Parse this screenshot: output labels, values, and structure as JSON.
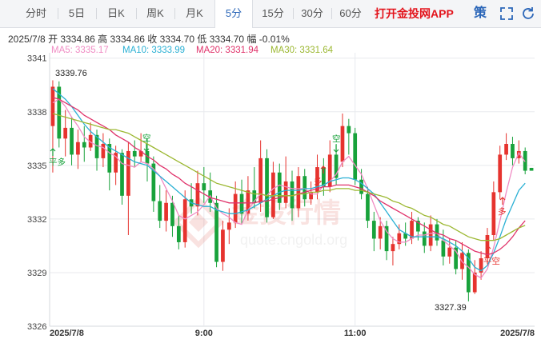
{
  "tabs": [
    {
      "label": "分时"
    },
    {
      "label": "5日"
    },
    {
      "label": "日K"
    },
    {
      "label": "周K"
    },
    {
      "label": "月K"
    },
    {
      "label": "5分"
    },
    {
      "label": "15分"
    },
    {
      "label": "30分"
    },
    {
      "label": "60分"
    }
  ],
  "active_tab": "5分",
  "promo_text": "打开金投网APP",
  "strategy_label": "策",
  "icons": [
    "fullscreen-icon",
    "refresh-icon"
  ],
  "info": {
    "date": "2025/7/8",
    "open_label": "开",
    "open": "3334.86",
    "high_label": "高",
    "high": "3334.86",
    "close_label": "收",
    "close": "3334.70",
    "low_label": "低",
    "low": "3334.70",
    "amp_label": "幅",
    "amp": "-0.01%"
  },
  "ma_legend": [
    {
      "text": "MA5: 3335.17",
      "color": "#f08cc4"
    },
    {
      "text": "MA10: 3333.99",
      "color": "#2ab0d4"
    },
    {
      "text": "MA20: 3331.94",
      "color": "#e0336b"
    },
    {
      "text": "MA30: 3331.64",
      "color": "#9cb832"
    }
  ],
  "watermark": {
    "text": "金投行情",
    "url": "quote.cngold.org"
  },
  "colors": {
    "up": "#e6332e",
    "down": "#18a23b"
  },
  "chart_data": {
    "type": "candlestick",
    "yticks": [
      3341,
      3338,
      3335,
      3332,
      3329,
      3326
    ],
    "ylim": [
      3326,
      3341.3
    ],
    "xlabels": [
      {
        "text": "2025/7/8",
        "index": 0
      },
      {
        "text": "9:00",
        "index": 24
      },
      {
        "text": "11:00",
        "index": 48
      },
      {
        "text": "2025/7/8",
        "index": 72
      }
    ],
    "annotations": [
      {
        "text": "3339.76",
        "type": "high"
      },
      {
        "text": "3327.39",
        "type": "low"
      },
      {
        "text": "平多",
        "type": "signal"
      },
      {
        "text": "空",
        "type": "signal"
      },
      {
        "text": "空",
        "type": "signal"
      },
      {
        "text": "多",
        "type": "signal"
      },
      {
        "text": "多",
        "type": "signal"
      },
      {
        "text": "平空",
        "type": "signal"
      }
    ],
    "candles": [
      [
        3337.2,
        3339.4,
        3339.76,
        3334.6
      ],
      [
        3339.4,
        3336.5,
        3339.7,
        3336.0
      ],
      [
        3336.5,
        3337.1,
        3338.1,
        3335.5
      ],
      [
        3337.1,
        3335.6,
        3337.7,
        3335.0
      ],
      [
        3335.6,
        3336.3,
        3337.0,
        3334.8
      ],
      [
        3336.3,
        3336.0,
        3337.2,
        3335.2
      ],
      [
        3336.0,
        3336.7,
        3337.4,
        3335.8
      ],
      [
        3336.7,
        3335.4,
        3337.0,
        3334.7
      ],
      [
        3335.4,
        3336.2,
        3336.8,
        3334.9
      ],
      [
        3336.2,
        3334.6,
        3336.5,
        3333.6
      ],
      [
        3334.6,
        3335.7,
        3336.1,
        3333.9
      ],
      [
        3335.7,
        3333.3,
        3335.9,
        3332.8
      ],
      [
        3333.3,
        3335.8,
        3336.3,
        3331.1
      ],
      [
        3335.8,
        3335.5,
        3336.4,
        3334.9
      ],
      [
        3335.5,
        3335.8,
        3336.8,
        3335.2
      ],
      [
        3335.8,
        3335.1,
        3336.5,
        3334.1
      ],
      [
        3335.1,
        3333.0,
        3335.5,
        3332.4
      ],
      [
        3333.0,
        3331.9,
        3333.9,
        3331.5
      ],
      [
        3331.9,
        3332.9,
        3333.6,
        3331.3
      ],
      [
        3332.9,
        3331.6,
        3333.3,
        3331.0
      ],
      [
        3331.6,
        3330.7,
        3332.2,
        3330.3
      ],
      [
        3330.7,
        3333.1,
        3333.6,
        3330.4
      ],
      [
        3333.1,
        3332.7,
        3334.0,
        3332.3
      ],
      [
        3332.7,
        3334.0,
        3334.7,
        3332.2
      ],
      [
        3334.0,
        3333.6,
        3334.9,
        3332.9
      ],
      [
        3333.6,
        3332.9,
        3334.6,
        3332.4
      ],
      [
        3332.9,
        3329.6,
        3333.3,
        3329.3
      ],
      [
        3329.6,
        3331.4,
        3331.9,
        3329.1
      ],
      [
        3331.4,
        3331.8,
        3332.6,
        3330.6
      ],
      [
        3331.8,
        3333.4,
        3334.1,
        3331.5
      ],
      [
        3333.4,
        3332.3,
        3334.2,
        3331.7
      ],
      [
        3332.3,
        3333.6,
        3334.4,
        3331.9
      ],
      [
        3333.6,
        3332.9,
        3334.9,
        3332.6
      ],
      [
        3332.9,
        3335.4,
        3336.4,
        3332.4
      ],
      [
        3335.4,
        3332.1,
        3335.9,
        3331.8
      ],
      [
        3332.1,
        3334.6,
        3335.2,
        3332.0
      ],
      [
        3334.6,
        3332.9,
        3335.1,
        3332.5
      ],
      [
        3332.9,
        3334.1,
        3335.5,
        3332.6
      ],
      [
        3334.1,
        3332.6,
        3334.7,
        3331.9
      ],
      [
        3332.6,
        3334.4,
        3334.9,
        3332.1
      ],
      [
        3334.4,
        3333.1,
        3334.8,
        3332.7
      ],
      [
        3333.1,
        3333.5,
        3334.1,
        3332.8
      ],
      [
        3333.5,
        3334.9,
        3335.6,
        3333.1
      ],
      [
        3334.9,
        3333.8,
        3335.4,
        3333.3
      ],
      [
        3333.8,
        3335.6,
        3336.4,
        3333.5
      ],
      [
        3335.6,
        3334.3,
        3336.2,
        3333.9
      ],
      [
        3335.2,
        3337.2,
        3337.9,
        3334.9
      ],
      [
        3337.2,
        3336.8,
        3337.6,
        3335.6
      ],
      [
        3336.8,
        3334.2,
        3337.1,
        3333.9
      ],
      [
        3334.2,
        3333.4,
        3334.8,
        3333.1
      ],
      [
        3333.4,
        3331.9,
        3333.8,
        3331.5
      ],
      [
        3331.9,
        3330.9,
        3332.4,
        3330.2
      ],
      [
        3330.9,
        3331.6,
        3332.1,
        3330.3
      ],
      [
        3331.6,
        3330.2,
        3331.9,
        3329.7
      ],
      [
        3330.2,
        3330.6,
        3331.0,
        3329.4
      ],
      [
        3330.6,
        3331.2,
        3331.7,
        3330.3
      ],
      [
        3331.2,
        3330.9,
        3331.8,
        3330.5
      ],
      [
        3330.9,
        3331.9,
        3332.4,
        3330.6
      ],
      [
        3331.9,
        3331.3,
        3332.1,
        3330.8
      ],
      [
        3331.3,
        3330.5,
        3331.8,
        3330.1
      ],
      [
        3330.5,
        3331.7,
        3332.2,
        3330.2
      ],
      [
        3331.7,
        3330.8,
        3332.0,
        3330.5
      ],
      [
        3330.8,
        3329.9,
        3331.4,
        3329.4
      ],
      [
        3329.9,
        3330.4,
        3330.9,
        3329.5
      ],
      [
        3330.4,
        3329.2,
        3330.8,
        3328.9
      ],
      [
        3329.2,
        3330.1,
        3330.7,
        3328.6
      ],
      [
        3330.1,
        3327.9,
        3330.3,
        3327.39
      ],
      [
        3327.9,
        3329.0,
        3329.7,
        3327.8
      ],
      [
        3329.0,
        3329.8,
        3330.2,
        3328.6
      ],
      [
        3329.8,
        3331.1,
        3331.5,
        3329.5
      ],
      [
        3331.1,
        3333.5,
        3334.1,
        3330.8
      ],
      [
        3333.5,
        3335.6,
        3336.1,
        3333.1
      ],
      [
        3335.6,
        3336.2,
        3336.8,
        3335.3
      ],
      [
        3336.2,
        3335.4,
        3336.6,
        3335.0
      ],
      [
        3335.4,
        3335.8,
        3336.4,
        3335.1
      ],
      [
        3335.8,
        3334.7,
        3336.0,
        3334.5
      ],
      [
        3334.86,
        3334.7,
        3334.86,
        3334.7
      ]
    ],
    "series": [
      {
        "name": "MA5",
        "values": [
          3338.5,
          3338.7,
          3338.3,
          3337.7,
          3337.2,
          3336.6,
          3336.3,
          3336.1,
          3336.0,
          3335.7,
          3335.5,
          3335.1,
          3335.0,
          3334.9,
          3335.2,
          3335.1,
          3334.8,
          3334.4,
          3333.7,
          3333.0,
          3332.2,
          3332.0,
          3332.2,
          3332.4,
          3332.8,
          3333.3,
          3332.6,
          3332.3,
          3332.1,
          3331.8,
          3331.7,
          3332.5,
          3333.0,
          3333.4,
          3333.3,
          3333.7,
          3333.9,
          3333.8,
          3333.7,
          3333.7,
          3333.7,
          3333.4,
          3333.4,
          3333.9,
          3334.1,
          3334.5,
          3335.2,
          3335.5,
          3335.0,
          3334.5,
          3333.7,
          3332.8,
          3331.9,
          3331.3,
          3330.9,
          3330.7,
          3330.7,
          3330.9,
          3331.1,
          3331.1,
          3331.2,
          3331.2,
          3330.8,
          3330.5,
          3330.2,
          3329.6,
          3329.3,
          3328.9,
          3328.7,
          3329.2,
          3330.4,
          3331.9,
          3333.5,
          3334.9,
          3335.7,
          3335.2
        ]
      },
      {
        "name": "MA10",
        "values": [
          3339.3,
          3339.0,
          3338.7,
          3338.3,
          3337.8,
          3337.3,
          3336.9,
          3336.6,
          3336.3,
          3336.0,
          3335.8,
          3335.6,
          3335.4,
          3335.2,
          3335.1,
          3335.0,
          3334.7,
          3334.4,
          3334.1,
          3333.8,
          3333.5,
          3333.2,
          3332.9,
          3332.8,
          3332.7,
          3332.7,
          3332.5,
          3332.4,
          3332.3,
          3332.3,
          3332.4,
          3332.5,
          3332.7,
          3332.9,
          3333.1,
          3333.3,
          3333.5,
          3333.6,
          3333.6,
          3333.6,
          3333.7,
          3333.7,
          3333.8,
          3333.9,
          3334.1,
          3334.2,
          3334.3,
          3334.3,
          3334.2,
          3334.0,
          3333.7,
          3333.4,
          3332.9,
          3332.4,
          3331.9,
          3331.4,
          3331.2,
          3331.0,
          3331.0,
          3331.0,
          3331.0,
          3331.0,
          3330.9,
          3330.7,
          3330.5,
          3330.2,
          3329.8,
          3329.3,
          3329.1,
          3329.4,
          3330.1,
          3331.0,
          3332.0,
          3332.8,
          3333.6,
          3334.0
        ]
      },
      {
        "name": "MA20",
        "values": [
          3338.8,
          3338.7,
          3338.5,
          3338.3,
          3338.1,
          3337.8,
          3337.6,
          3337.4,
          3337.2,
          3337.0,
          3336.7,
          3336.5,
          3336.3,
          3336.0,
          3335.8,
          3335.5,
          3335.3,
          3335.0,
          3334.8,
          3334.5,
          3334.3,
          3334.0,
          3333.8,
          3333.6,
          3333.4,
          3333.2,
          3333.1,
          3333.0,
          3332.9,
          3332.9,
          3332.9,
          3332.9,
          3332.9,
          3333.0,
          3333.0,
          3333.1,
          3333.2,
          3333.3,
          3333.3,
          3333.4,
          3333.5,
          3333.6,
          3333.7,
          3333.8,
          3333.8,
          3333.9,
          3333.9,
          3333.9,
          3333.8,
          3333.7,
          3333.5,
          3333.3,
          3333.0,
          3332.8,
          3332.6,
          3332.4,
          3332.2,
          3332.0,
          3331.8,
          3331.6,
          3331.4,
          3331.2,
          3331.1,
          3330.9,
          3330.8,
          3330.6,
          3330.4,
          3330.2,
          3330.1,
          3330.0,
          3330.1,
          3330.3,
          3330.6,
          3331.0,
          3331.5,
          3331.9
        ]
      },
      {
        "name": "MA30",
        "values": [
          3337.9,
          3337.8,
          3337.7,
          3337.6,
          3337.5,
          3337.4,
          3337.3,
          3337.2,
          3337.1,
          3337.0,
          3337.0,
          3336.9,
          3336.8,
          3336.6,
          3336.4,
          3336.2,
          3336.0,
          3335.8,
          3335.6,
          3335.4,
          3335.2,
          3335.0,
          3334.8,
          3334.6,
          3334.4,
          3334.2,
          3334.0,
          3333.9,
          3333.8,
          3333.7,
          3333.6,
          3333.5,
          3333.4,
          3333.4,
          3333.3,
          3333.3,
          3333.3,
          3333.3,
          3333.3,
          3333.4,
          3333.4,
          3333.5,
          3333.5,
          3333.6,
          3333.6,
          3333.7,
          3333.7,
          3333.7,
          3333.6,
          3333.6,
          3333.5,
          3333.4,
          3333.3,
          3333.2,
          3333.0,
          3332.9,
          3332.7,
          3332.6,
          3332.4,
          3332.2,
          3332.1,
          3331.9,
          3331.7,
          3331.6,
          3331.4,
          3331.2,
          3331.0,
          3330.9,
          3330.8,
          3330.8,
          3330.8,
          3330.9,
          3331.1,
          3331.3,
          3331.5,
          3331.64
        ]
      }
    ]
  }
}
